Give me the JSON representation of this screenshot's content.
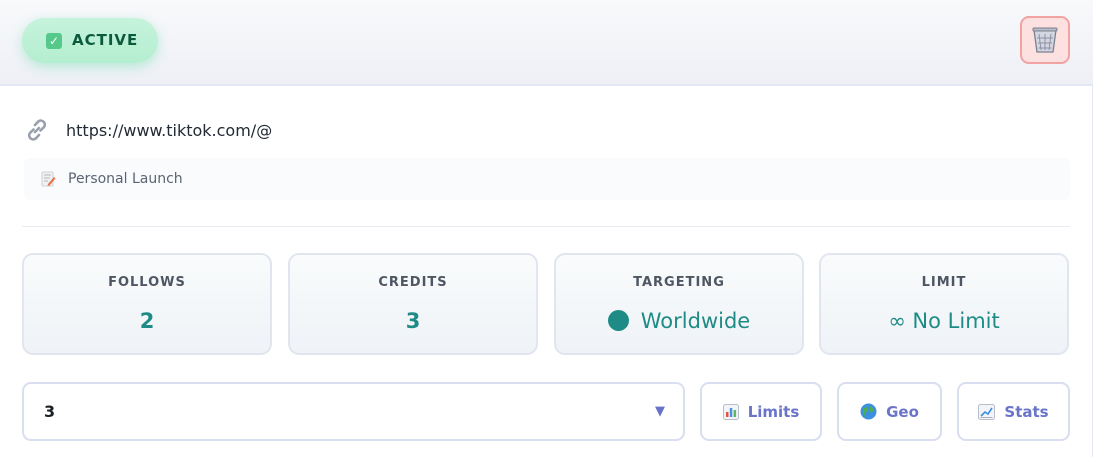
{
  "header": {
    "status_label": "ACTIVE",
    "status_color": "#0c5a3c",
    "status_bg": "#c6f3dc"
  },
  "details": {
    "url": "https://www.tiktok.com/@",
    "campaign_name": "Personal Launch"
  },
  "stats": [
    {
      "label": "FOLLOWS",
      "value": "2"
    },
    {
      "label": "CREDITS",
      "value": "3"
    },
    {
      "label": "TARGETING",
      "value": "Worldwide"
    },
    {
      "label": "LIMIT",
      "value": "∞ No Limit"
    }
  ],
  "controls": {
    "select_value": "3",
    "buttons": [
      "Limits",
      "Geo",
      "Stats"
    ]
  },
  "colors": {
    "accent_teal": "#1f8b86",
    "button_text": "#6a74c9",
    "delete_bg": "#fde1e1"
  },
  "icons": {
    "status": "check-box-icon",
    "delete": "wastebasket-icon",
    "url": "link-icon",
    "campaign": "memo-icon",
    "targeting": "globe-dot-icon",
    "limits": "bar-chart-icon",
    "geo": "globe-icon",
    "stats": "trend-chart-icon"
  }
}
